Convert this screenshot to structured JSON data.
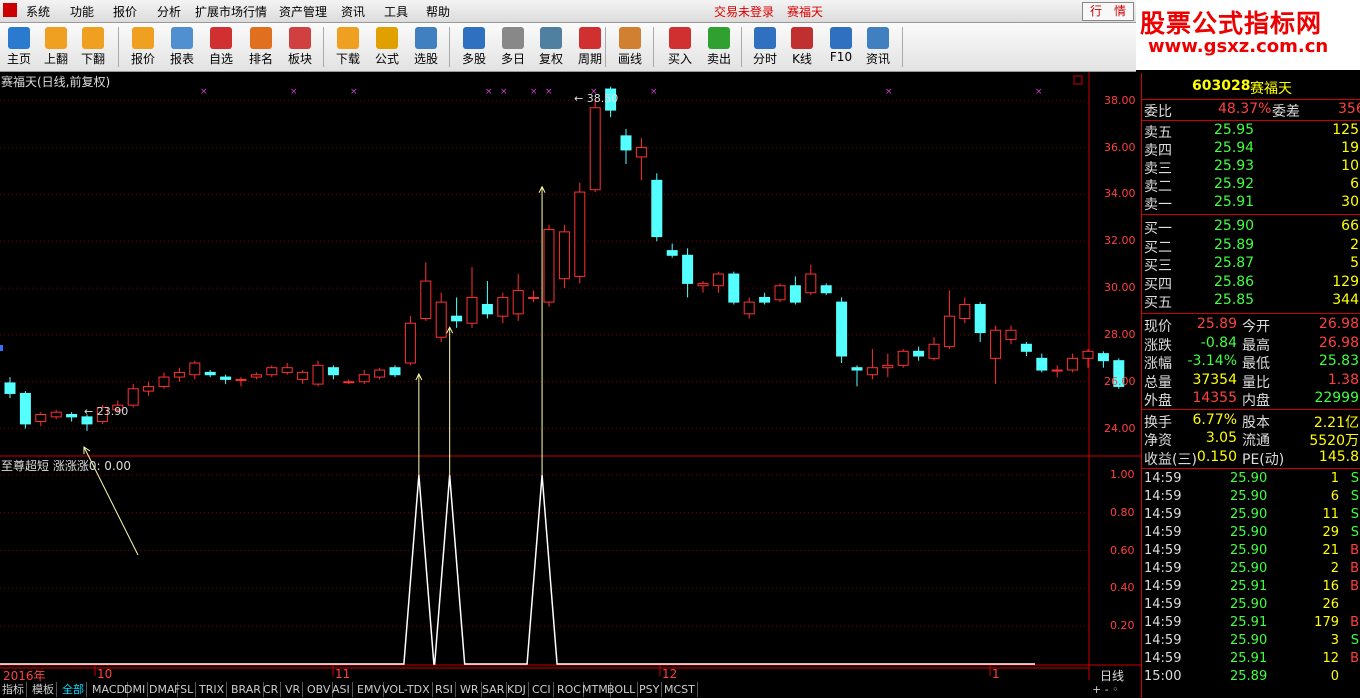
{
  "menu": [
    "系统",
    "功能",
    "报价",
    "分析",
    "扩展市场行情",
    "资产管理",
    "资讯",
    "工具",
    "帮助"
  ],
  "login": {
    "status": "交易未登录",
    "name": "赛福天"
  },
  "hq_button": "行　情",
  "brand": {
    "title": "股票公式指标网",
    "url": "www.gsxz.com.cn"
  },
  "toolbar": [
    {
      "label": "主页",
      "color": "#2a7ad0"
    },
    {
      "label": "上翻",
      "color": "#f0a020"
    },
    {
      "label": "下翻",
      "color": "#f0a020"
    },
    {
      "label": "报价",
      "color": "#f0a020"
    },
    {
      "label": "报表",
      "color": "#5090d0"
    },
    {
      "label": "自选",
      "color": "#d03030"
    },
    {
      "label": "排名",
      "color": "#e07020"
    },
    {
      "label": "板块",
      "color": "#d04040"
    },
    {
      "label": "下载",
      "color": "#f0a020"
    },
    {
      "label": "公式",
      "color": "#e0a000"
    },
    {
      "label": "选股",
      "color": "#4080c0"
    },
    {
      "label": "多股",
      "color": "#3070c0"
    },
    {
      "label": "多日",
      "color": "#888888"
    },
    {
      "label": "复权",
      "color": "#5080a0"
    },
    {
      "label": "周期",
      "color": "#d03030"
    },
    {
      "label": "画线",
      "color": "#d08030"
    },
    {
      "label": "买入",
      "color": "#d03030"
    },
    {
      "label": "卖出",
      "color": "#30a030"
    },
    {
      "label": "分时",
      "color": "#3070c0"
    },
    {
      "label": "K线",
      "color": "#c03030"
    },
    {
      "label": "F10",
      "color": "#3070c0"
    },
    {
      "label": "资讯",
      "color": "#4080c0"
    }
  ],
  "chart": {
    "title": "赛福天(日线,前复权)",
    "high_label": "38.50",
    "low_label": "23.90",
    "indicator_label": "至尊超短 涨涨涨0: 0.00",
    "price_ticks": [
      "38.00",
      "36.00",
      "34.00",
      "32.00",
      "30.00",
      "28.00",
      "26.00",
      "24.00"
    ],
    "ind_ticks": [
      "1.00",
      "0.80",
      "0.60",
      "0.40",
      "0.20"
    ],
    "dates": [
      "2016年",
      "10",
      "11",
      "12",
      "1"
    ],
    "period": "日线"
  },
  "chart_data": {
    "type": "candlestick",
    "ylim": [
      23.0,
      38.8
    ],
    "candles": [
      [
        25.95,
        25.5,
        26.2,
        25.3
      ],
      [
        25.5,
        24.2,
        25.6,
        24.0
      ],
      [
        24.3,
        24.6,
        24.7,
        24.1
      ],
      [
        24.5,
        24.7,
        24.8,
        24.4
      ],
      [
        24.6,
        24.5,
        24.7,
        24.3
      ],
      [
        24.5,
        24.2,
        24.6,
        23.9
      ],
      [
        24.3,
        24.9,
        25.0,
        24.2
      ],
      [
        24.8,
        25.0,
        25.2,
        24.7
      ],
      [
        25.0,
        25.7,
        25.9,
        24.9
      ],
      [
        25.6,
        25.8,
        26.0,
        25.4
      ],
      [
        25.8,
        26.2,
        26.4,
        25.7
      ],
      [
        26.2,
        26.4,
        26.6,
        26.0
      ],
      [
        26.3,
        26.8,
        26.9,
        26.1
      ],
      [
        26.4,
        26.3,
        26.5,
        26.2
      ],
      [
        26.2,
        26.1,
        26.3,
        25.9
      ],
      [
        26.1,
        26.1,
        26.2,
        25.8
      ],
      [
        26.2,
        26.3,
        26.4,
        26.1
      ],
      [
        26.3,
        26.6,
        26.7,
        26.2
      ],
      [
        26.4,
        26.6,
        26.8,
        26.3
      ],
      [
        26.1,
        26.4,
        26.5,
        25.9
      ],
      [
        25.9,
        26.7,
        26.9,
        25.8
      ],
      [
        26.6,
        26.3,
        26.7,
        26.1
      ],
      [
        26.0,
        26.0,
        26.1,
        25.9
      ],
      [
        26.0,
        26.3,
        26.5,
        25.9
      ],
      [
        26.2,
        26.5,
        26.6,
        26.1
      ],
      [
        26.6,
        26.3,
        26.7,
        26.2
      ],
      [
        26.8,
        28.5,
        28.8,
        26.7
      ],
      [
        28.7,
        30.3,
        31.1,
        28.6
      ],
      [
        27.9,
        29.4,
        29.8,
        27.7
      ],
      [
        28.8,
        28.6,
        29.6,
        28.3
      ],
      [
        28.5,
        29.6,
        30.9,
        28.3
      ],
      [
        29.3,
        28.9,
        30.3,
        28.7
      ],
      [
        28.8,
        29.6,
        29.8,
        28.5
      ],
      [
        28.9,
        29.9,
        30.6,
        28.6
      ],
      [
        29.6,
        29.6,
        29.9,
        29.4
      ],
      [
        29.4,
        32.5,
        32.7,
        29.2
      ],
      [
        30.4,
        32.4,
        32.7,
        30.0
      ],
      [
        30.5,
        34.1,
        34.5,
        30.2
      ],
      [
        34.2,
        37.7,
        38.1,
        34.1
      ],
      [
        38.5,
        37.6,
        38.6,
        37.3
      ],
      [
        36.5,
        35.9,
        36.8,
        35.3
      ],
      [
        35.6,
        36.0,
        36.4,
        34.6
      ],
      [
        34.6,
        32.2,
        34.9,
        32.0
      ],
      [
        31.6,
        31.4,
        31.9,
        31.3
      ],
      [
        31.4,
        30.2,
        31.7,
        29.6
      ],
      [
        30.1,
        30.2,
        30.3,
        29.8
      ],
      [
        30.1,
        30.6,
        30.7,
        29.8
      ],
      [
        30.6,
        29.4,
        30.7,
        29.3
      ],
      [
        28.9,
        29.4,
        29.6,
        28.7
      ],
      [
        29.6,
        29.4,
        29.8,
        29.3
      ],
      [
        29.5,
        30.1,
        30.2,
        29.4
      ],
      [
        30.1,
        29.4,
        30.5,
        29.3
      ],
      [
        29.8,
        30.6,
        31.0,
        29.7
      ],
      [
        30.1,
        29.8,
        30.2,
        29.7
      ],
      [
        29.4,
        27.1,
        29.6,
        26.8
      ],
      [
        26.6,
        26.5,
        26.7,
        25.8
      ],
      [
        26.3,
        26.6,
        27.4,
        26.1
      ],
      [
        26.6,
        26.7,
        27.2,
        26.2
      ],
      [
        26.7,
        27.3,
        27.4,
        26.6
      ],
      [
        27.3,
        27.1,
        27.5,
        26.9
      ],
      [
        27.0,
        27.6,
        27.9,
        26.9
      ],
      [
        27.5,
        28.8,
        29.9,
        27.4
      ],
      [
        28.7,
        29.3,
        29.6,
        28.5
      ],
      [
        29.3,
        28.1,
        29.4,
        27.7
      ],
      [
        27.0,
        28.2,
        28.4,
        25.9
      ],
      [
        27.8,
        28.2,
        28.4,
        27.6
      ],
      [
        27.6,
        27.3,
        27.7,
        27.1
      ],
      [
        27.0,
        26.5,
        27.2,
        26.4
      ],
      [
        26.5,
        26.5,
        26.7,
        26.2
      ],
      [
        26.5,
        27.0,
        27.2,
        26.4
      ],
      [
        27.0,
        27.3,
        27.4,
        26.6
      ],
      [
        27.2,
        26.9,
        27.3,
        26.6
      ],
      [
        26.9,
        25.8,
        27.0,
        25.7
      ]
    ],
    "indicator": {
      "ylim": [
        0,
        1.1
      ],
      "signals": [
        26.5,
        28.5,
        34.5
      ]
    }
  },
  "quote": {
    "code": "603028",
    "name": "赛福天",
    "wb_label": "委比",
    "wb": "48.37%",
    "wc_label": "委差",
    "wc": "356",
    "sell": [
      {
        "label": "卖五",
        "price": "25.95",
        "vol": "125"
      },
      {
        "label": "卖四",
        "price": "25.94",
        "vol": "19"
      },
      {
        "label": "卖三",
        "price": "25.93",
        "vol": "10"
      },
      {
        "label": "卖二",
        "price": "25.92",
        "vol": "6"
      },
      {
        "label": "卖一",
        "price": "25.91",
        "vol": "30"
      }
    ],
    "buy": [
      {
        "label": "买一",
        "price": "25.90",
        "vol": "66"
      },
      {
        "label": "买二",
        "price": "25.89",
        "vol": "2"
      },
      {
        "label": "买三",
        "price": "25.87",
        "vol": "5"
      },
      {
        "label": "买四",
        "price": "25.86",
        "vol": "129"
      },
      {
        "label": "买五",
        "price": "25.85",
        "vol": "344"
      }
    ],
    "stats": [
      [
        "现价",
        "25.89",
        "今开",
        "26.98"
      ],
      [
        "涨跌",
        "-0.84",
        "最高",
        "26.98"
      ],
      [
        "涨幅",
        "-3.14%",
        "最低",
        "25.83"
      ],
      [
        "总量",
        "37354",
        "量比",
        "1.38"
      ],
      [
        "外盘",
        "14355",
        "内盘",
        "22999"
      ]
    ],
    "stats2": [
      [
        "换手",
        "6.77%",
        "股本",
        "2.21亿"
      ],
      [
        "净资",
        "3.05",
        "流通",
        "5520万"
      ],
      [
        "收益(三)",
        "0.150",
        "PE(动)",
        "145.8"
      ]
    ],
    "ticks": [
      [
        "14:59",
        "25.90",
        "1",
        "S"
      ],
      [
        "14:59",
        "25.90",
        "6",
        "S"
      ],
      [
        "14:59",
        "25.90",
        "11",
        "S"
      ],
      [
        "14:59",
        "25.90",
        "29",
        "S"
      ],
      [
        "14:59",
        "25.90",
        "21",
        "B"
      ],
      [
        "14:59",
        "25.90",
        "2",
        "B"
      ],
      [
        "14:59",
        "25.91",
        "16",
        "B"
      ],
      [
        "14:59",
        "25.90",
        "26",
        ""
      ],
      [
        "14:59",
        "25.91",
        "179",
        "B"
      ],
      [
        "14:59",
        "25.90",
        "3",
        "S"
      ],
      [
        "14:59",
        "25.91",
        "12",
        "B"
      ],
      [
        "15:00",
        "25.89",
        "0",
        ""
      ]
    ]
  },
  "tabs": [
    "指标",
    "模板",
    "全部",
    "MACD",
    "DMI",
    "DMA",
    "FSL",
    "TRIX",
    "BRAR",
    "CR",
    "VR",
    "OBV",
    "ASI",
    "EMV",
    "VOL-TDX",
    "RSI",
    "WR",
    "SAR",
    "KDJ",
    "CCI",
    "ROC",
    "MTM",
    "BOLL",
    "PSY",
    "MCST"
  ]
}
